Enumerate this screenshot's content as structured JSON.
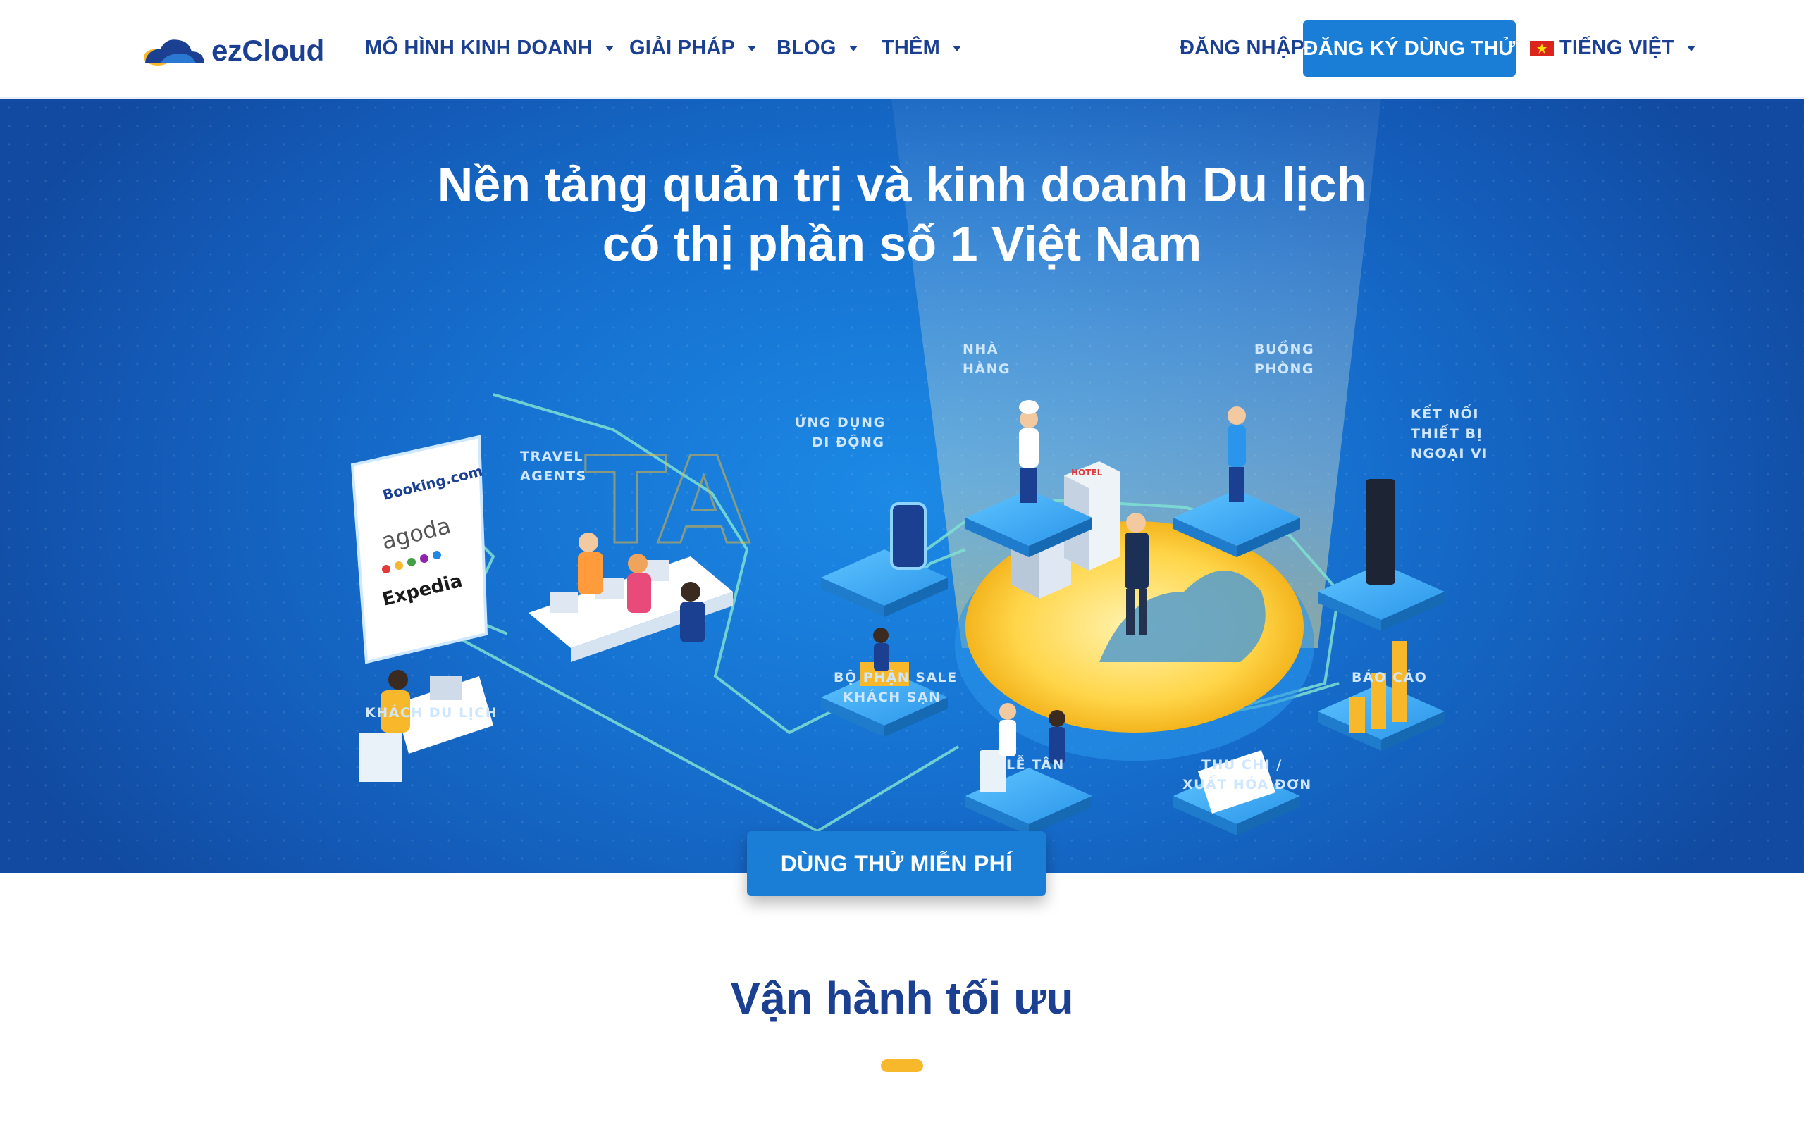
{
  "brand": {
    "name": "ezCloud",
    "logo_icon": "cloud-icon"
  },
  "nav": {
    "items": [
      {
        "label": "MÔ HÌNH KINH DOANH"
      },
      {
        "label": "GIẢI PHÁP"
      },
      {
        "label": "BLOG"
      },
      {
        "label": "THÊM"
      }
    ],
    "login_label": "ĐĂNG NHẬP",
    "trial_label": "ĐĂNG KÝ DÙNG THỬ",
    "language_label": "TIẾNG VIỆT",
    "language_flag": "vietnam-flag-icon"
  },
  "hero": {
    "title_line1": "Nền tảng quản trị và kinh doanh Du lịch",
    "title_line2": "có thị phần số 1 Việt Nam",
    "cta_label": "DÙNG THỬ MIỄN PHÍ",
    "illustration": {
      "ota_brands": [
        "Booking.com",
        "agoda",
        "Expedia"
      ],
      "labels": {
        "travel_agents": [
          "TRAVEL",
          "AGENTS"
        ],
        "mobile_app": [
          "ỨNG DỤNG",
          "DI ĐỘNG"
        ],
        "restaurant": [
          "NHÀ",
          "HÀNG"
        ],
        "housekeeping": [
          "BUỒNG",
          "PHÒNG"
        ],
        "devices": [
          "KẾT NỐI",
          "THIẾT BỊ",
          "NGOẠI VI"
        ],
        "traveler": [
          "KHÁCH DU LỊCH"
        ],
        "sales": [
          "BỘ PHẬN SALE",
          "KHÁCH SẠN"
        ],
        "reports": [
          "BÁO CÁO"
        ],
        "reception": [
          "LỄ TÂN"
        ],
        "finance": [
          "THU CHI /",
          "XUẤT HÓA ĐƠN"
        ],
        "hotel_sign": "HOTEL"
      }
    }
  },
  "section": {
    "title": "Vận hành tối ưu"
  },
  "colors": {
    "brand_navy": "#1b3f91",
    "primary_button": "#1a7ed6",
    "hero_blue": "#1670cf",
    "accent_yellow": "#f7b92b"
  }
}
